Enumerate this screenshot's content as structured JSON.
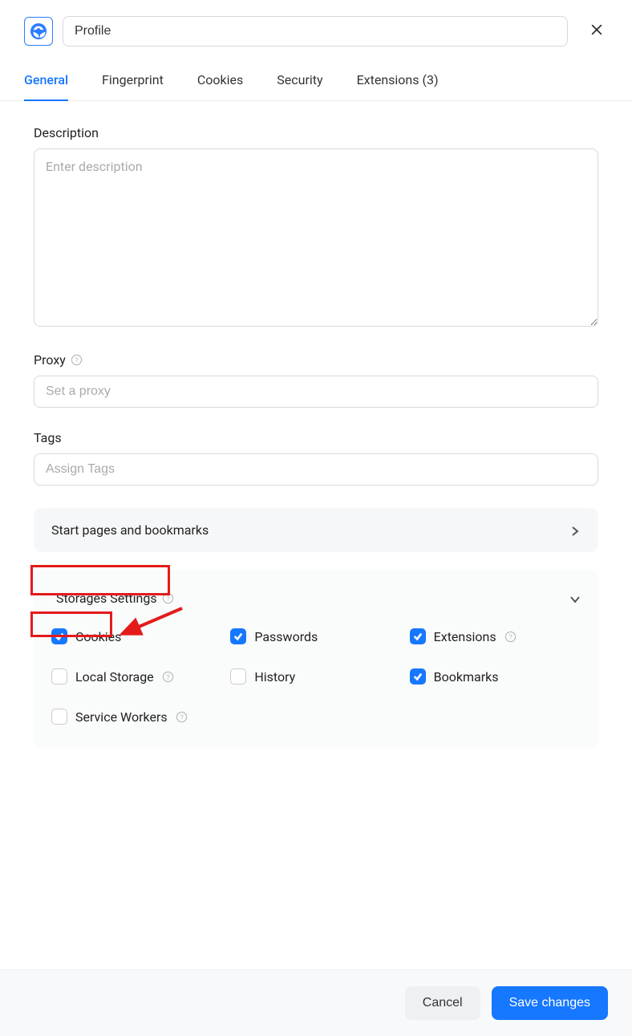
{
  "header": {
    "profile_name": "Profile"
  },
  "tabs": [
    {
      "label": "General",
      "active": true
    },
    {
      "label": "Fingerprint",
      "active": false
    },
    {
      "label": "Cookies",
      "active": false
    },
    {
      "label": "Security",
      "active": false
    },
    {
      "label": "Extensions (3)",
      "active": false
    }
  ],
  "fields": {
    "description": {
      "label": "Description",
      "placeholder": "Enter description",
      "value": ""
    },
    "proxy": {
      "label": "Proxy",
      "placeholder": "Set a proxy",
      "value": ""
    },
    "tags": {
      "label": "Tags",
      "placeholder": "Assign Tags",
      "value": ""
    }
  },
  "accordion": {
    "start_pages": "Start pages and bookmarks"
  },
  "storages": {
    "title": "Storages Settings",
    "items": [
      {
        "label": "Cookies",
        "checked": true,
        "help": false
      },
      {
        "label": "Passwords",
        "checked": true,
        "help": false
      },
      {
        "label": "Extensions",
        "checked": true,
        "help": true
      },
      {
        "label": "Local Storage",
        "checked": false,
        "help": true
      },
      {
        "label": "History",
        "checked": false,
        "help": false
      },
      {
        "label": "Bookmarks",
        "checked": true,
        "help": false
      },
      {
        "label": "Service Workers",
        "checked": false,
        "help": true
      }
    ]
  },
  "footer": {
    "cancel": "Cancel",
    "save": "Save changes"
  },
  "colors": {
    "accent": "#1677ff",
    "annotation": "#e31b1b"
  }
}
